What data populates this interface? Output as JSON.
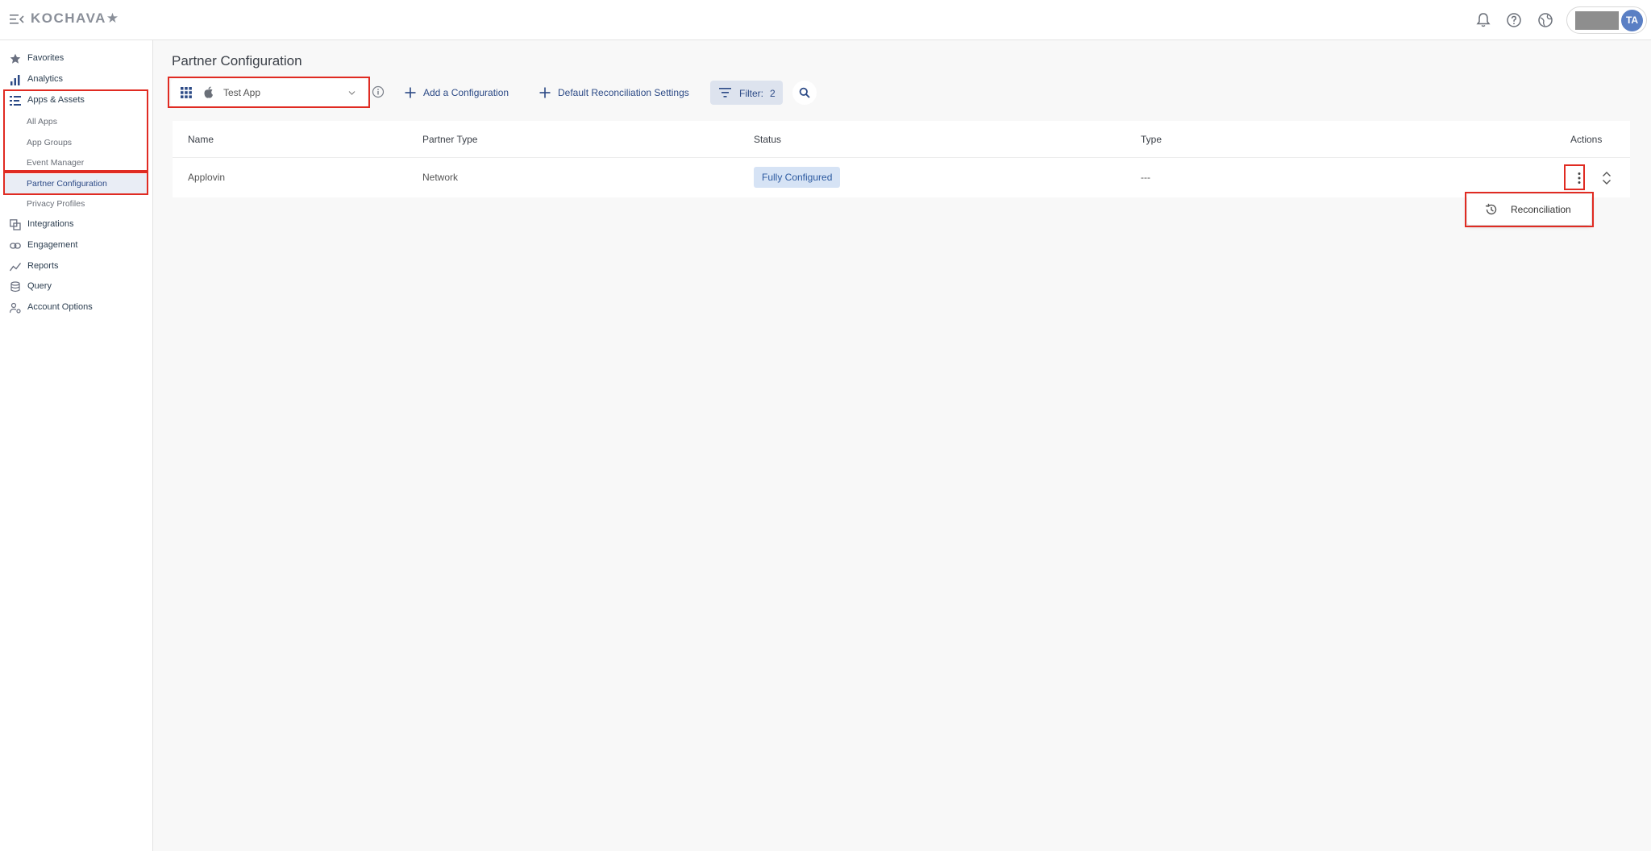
{
  "app": {
    "logo": "KOCHAVA★",
    "user_initials": "TA"
  },
  "sidebar": {
    "items": [
      {
        "label": "Favorites"
      },
      {
        "label": "Analytics"
      },
      {
        "label": "Apps & Assets"
      },
      {
        "label": "All Apps"
      },
      {
        "label": "App Groups"
      },
      {
        "label": "Event Manager"
      },
      {
        "label": "Partner Configuration"
      },
      {
        "label": "Privacy Profiles"
      },
      {
        "label": "Integrations"
      },
      {
        "label": "Engagement"
      },
      {
        "label": "Reports"
      },
      {
        "label": "Query"
      },
      {
        "label": "Account Options"
      }
    ]
  },
  "main": {
    "title": "Partner Configuration",
    "app_selector": {
      "value": "Test App"
    },
    "toolbar": {
      "add_config": "Add a Configuration",
      "default_recon": "Default Reconciliation Settings",
      "filter_label": "Filter:",
      "filter_count": "2"
    },
    "table": {
      "headers": {
        "name": "Name",
        "partner_type": "Partner Type",
        "status": "Status",
        "type": "Type",
        "actions": "Actions"
      },
      "rows": [
        {
          "name": "Applovin",
          "partner_type": "Network",
          "status": "Fully Configured",
          "type": "---"
        }
      ]
    },
    "actions_menu": {
      "items": [
        {
          "label": "Reconciliation"
        }
      ]
    }
  },
  "colors": {
    "accent": "#2c4a86",
    "highlight": "#e02b22",
    "badge_bg": "#d6e3f5"
  }
}
